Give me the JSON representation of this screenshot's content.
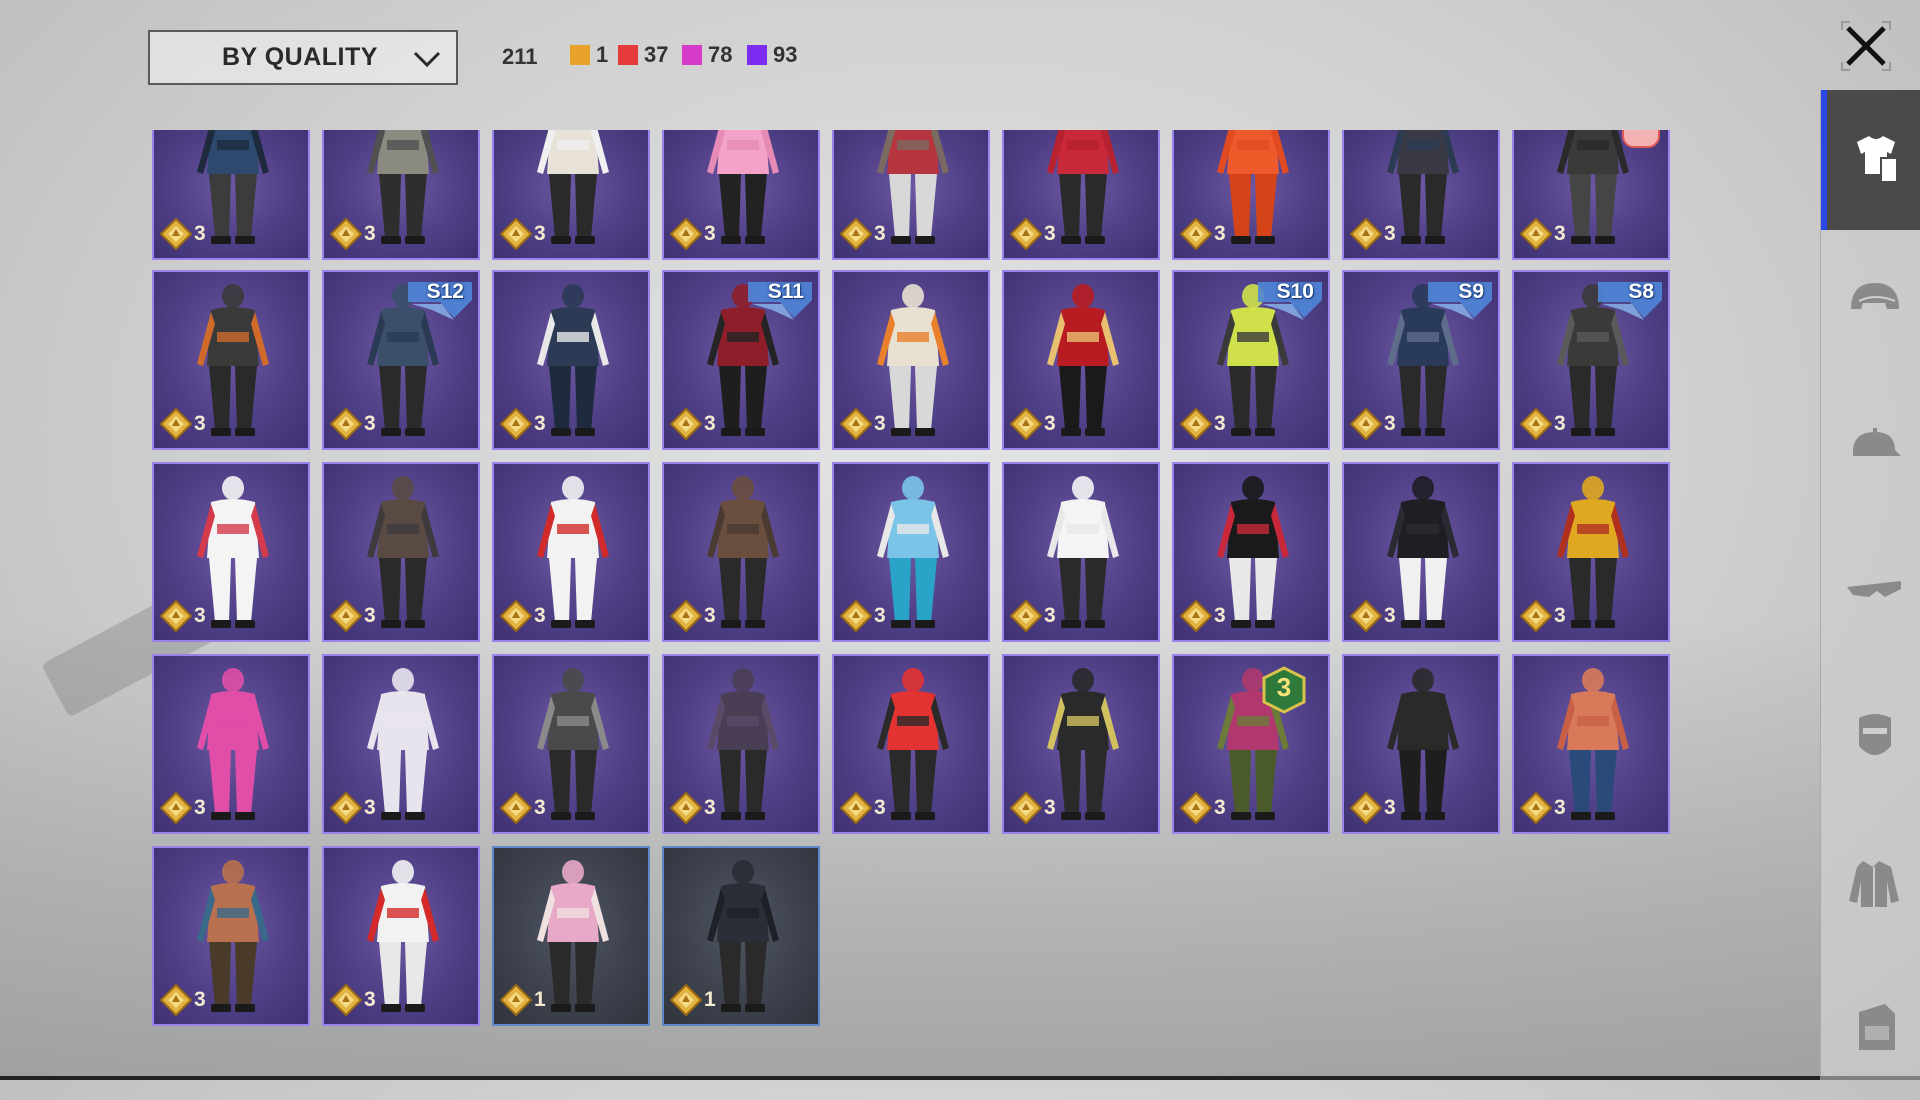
{
  "header": {
    "sort_label": "BY QUALITY",
    "total": "211",
    "quality_counts": [
      {
        "color": "#e8a22a",
        "count": "1"
      },
      {
        "color": "#e53b3b",
        "count": "37"
      },
      {
        "color": "#d63bc9",
        "count": "78"
      },
      {
        "color": "#7b2cf0",
        "count": "93"
      }
    ]
  },
  "outfit_colors": [
    [
      "#2d4a6e",
      "#1e2a3e",
      "#3c3c3c"
    ],
    [
      "#8a8a80",
      "#505050",
      "#2e2e2e"
    ],
    [
      "#e9e2d8",
      "#f0f0f0",
      "#2a2a2a"
    ],
    [
      "#f4a3c8",
      "#e68bb6",
      "#222"
    ],
    [
      "#b5363e",
      "#7a6a62",
      "#d8d8d8"
    ],
    [
      "#c8283a",
      "#b82130",
      "#2a2a2a"
    ],
    [
      "#ef5a2a",
      "#e24a20",
      "#d54418"
    ],
    [
      "#3a3a44",
      "#2c3b52",
      "#2a2a2a"
    ],
    [
      "#3a3a3a",
      "#2a2a2a",
      "#454545"
    ],
    [
      "#3a3a3a",
      "#cf6a2a",
      "#2a2a2a"
    ],
    [
      "#3b4f6a",
      "#2a3a55",
      "#2a2a2a"
    ],
    [
      "#2c3a56",
      "#e8e8e8",
      "#1e2a3e"
    ],
    [
      "#8e1f2a",
      "#242424",
      "#1e1e1e"
    ],
    [
      "#e8e0d0",
      "#e9802c",
      "#d8d8d8"
    ],
    [
      "#b81c22",
      "#e8c070",
      "#1a1a1a"
    ],
    [
      "#cfe04a",
      "#3a3a3a",
      "#2a2a2a"
    ],
    [
      "#2a3a5a",
      "#5d6d8a",
      "#2a2a2a"
    ],
    [
      "#3a3a3a",
      "#5a5a5a",
      "#2a2a2a"
    ],
    [
      "#f4f4f4",
      "#d43a4a",
      "#f4f4f4"
    ],
    [
      "#5a4a44",
      "#3e3a3e",
      "#2a2a2a"
    ],
    [
      "#f2f2f2",
      "#d22a2a",
      "#f2f2f2"
    ],
    [
      "#6a4e3e",
      "#4a3a32",
      "#2a2a2a"
    ],
    [
      "#7ac4e8",
      "#e8e8e8",
      "#2aa3c8"
    ],
    [
      "#f4f4f4",
      "#e8e8e8",
      "#2a2a2a"
    ],
    [
      "#1a1a1a",
      "#c8283a",
      "#e8e8e8"
    ],
    [
      "#1e1e24",
      "#2a2a32",
      "#f0f0f0"
    ],
    [
      "#e0a820",
      "#b03020",
      "#2a2a2a"
    ],
    [
      "#e04ea8",
      "#e04ea8",
      "#e04ea8"
    ],
    [
      "#e8e4ee",
      "#e8e4ee",
      "#e8e4ee"
    ],
    [
      "#4a4a4a",
      "#8a8a8a",
      "#2a2a2a"
    ],
    [
      "#4a3e55",
      "#5a4a68",
      "#2a2a2a"
    ],
    [
      "#e23232",
      "#2a2a2a",
      "#2a2a2a"
    ],
    [
      "#2a2a2a",
      "#d0c060",
      "#2a2a2a"
    ],
    [
      "#b0386e",
      "#6c7a3a",
      "#4a5a2a"
    ],
    [
      "#2a2a2a",
      "#2a2a2a",
      "#1e1e1e"
    ],
    [
      "#d87a5a",
      "#c86048",
      "#2a4a7a"
    ],
    [
      "#b8704e",
      "#3a6a8a",
      "#4a3a2a"
    ],
    [
      "#f2f2f2",
      "#d42a2a",
      "#e8e8e8"
    ],
    [
      "#e8a8c8",
      "#f0e0e0",
      "#2a2a2a"
    ],
    [
      "#2a2e36",
      "#1e2228",
      "#2a2a2a"
    ]
  ],
  "tiles": [
    {
      "count": "3",
      "rarity": "epic"
    },
    {
      "count": "3",
      "rarity": "epic"
    },
    {
      "count": "3",
      "rarity": "epic"
    },
    {
      "count": "3",
      "rarity": "epic"
    },
    {
      "count": "3",
      "rarity": "epic"
    },
    {
      "count": "3",
      "rarity": "epic"
    },
    {
      "count": "3",
      "rarity": "epic"
    },
    {
      "count": "3",
      "rarity": "epic"
    },
    {
      "count": "3",
      "rarity": "epic",
      "new": true
    },
    {
      "count": "3",
      "rarity": "epic"
    },
    {
      "count": "3",
      "rarity": "epic",
      "season": "S12"
    },
    {
      "count": "3",
      "rarity": "epic"
    },
    {
      "count": "3",
      "rarity": "epic",
      "season": "S11"
    },
    {
      "count": "3",
      "rarity": "epic"
    },
    {
      "count": "3",
      "rarity": "epic"
    },
    {
      "count": "3",
      "rarity": "epic",
      "season": "S10"
    },
    {
      "count": "3",
      "rarity": "epic",
      "season": "S9"
    },
    {
      "count": "3",
      "rarity": "epic",
      "season": "S8"
    },
    {
      "count": "3",
      "rarity": "epic"
    },
    {
      "count": "3",
      "rarity": "epic"
    },
    {
      "count": "3",
      "rarity": "epic"
    },
    {
      "count": "3",
      "rarity": "epic"
    },
    {
      "count": "3",
      "rarity": "epic"
    },
    {
      "count": "3",
      "rarity": "epic"
    },
    {
      "count": "3",
      "rarity": "epic"
    },
    {
      "count": "3",
      "rarity": "epic"
    },
    {
      "count": "3",
      "rarity": "epic"
    },
    {
      "count": "3",
      "rarity": "epic"
    },
    {
      "count": "3",
      "rarity": "epic"
    },
    {
      "count": "3",
      "rarity": "epic"
    },
    {
      "count": "3",
      "rarity": "epic"
    },
    {
      "count": "3",
      "rarity": "epic"
    },
    {
      "count": "3",
      "rarity": "epic"
    },
    {
      "count": "3",
      "rarity": "epic",
      "level": "3"
    },
    {
      "count": "3",
      "rarity": "epic"
    },
    {
      "count": "3",
      "rarity": "epic"
    },
    {
      "count": "3",
      "rarity": "epic"
    },
    {
      "count": "3",
      "rarity": "epic"
    },
    {
      "count": "1",
      "rarity": "common"
    },
    {
      "count": "1",
      "rarity": "common"
    }
  ],
  "categories": [
    {
      "name": "outfit-set",
      "icon": "outfit-set-icon",
      "active": true
    },
    {
      "name": "helmet",
      "icon": "helmet-icon",
      "active": false
    },
    {
      "name": "cap",
      "icon": "cap-icon",
      "active": false
    },
    {
      "name": "glasses",
      "icon": "glasses-icon",
      "active": false
    },
    {
      "name": "mask",
      "icon": "mask-icon",
      "active": false
    },
    {
      "name": "jacket",
      "icon": "jacket-icon",
      "active": false
    },
    {
      "name": "backpack",
      "icon": "backpack-icon",
      "active": false
    }
  ]
}
